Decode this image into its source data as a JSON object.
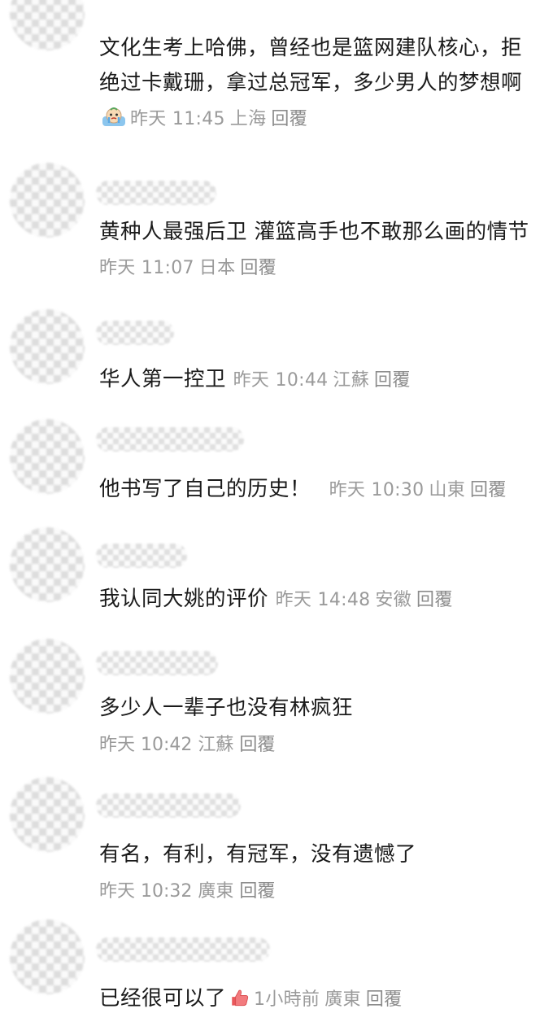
{
  "comments": [
    {
      "text": "文化生考上哈佛，曾经也是篮网建队核心，拒绝过卡戴珊，拿过总冠军，多少男人的梦想啊",
      "emoji": "crying-face-emoji",
      "time": "昨天 11:45",
      "location": "上海",
      "reply": "回覆"
    },
    {
      "text": "黄种人最强后卫 灌篮高手也不敢那么画的情节",
      "time": "昨天 11:07",
      "location": "日本",
      "reply": "回覆"
    },
    {
      "text": "华人第一控卫",
      "time": "昨天 10:44",
      "location": "江蘇",
      "reply": "回覆"
    },
    {
      "text": "他书写了自己的历史！",
      "time": "昨天 10:30",
      "location": "山東",
      "reply": "回覆"
    },
    {
      "text": "我认同大姚的评价",
      "time": "昨天 14:48",
      "location": "安徽",
      "reply": "回覆"
    },
    {
      "text": "多少人一辈子也没有林疯狂",
      "time": "昨天 10:42",
      "location": "江蘇",
      "reply": "回覆"
    },
    {
      "text": "有名，有利，有冠军，没有遗憾了",
      "time": "昨天 10:32",
      "location": "廣東",
      "reply": "回覆"
    },
    {
      "text": "已经很可以了",
      "emoji": "thumbs-up-emoji",
      "time": "1小時前",
      "location": "廣東",
      "reply": "回覆"
    }
  ]
}
